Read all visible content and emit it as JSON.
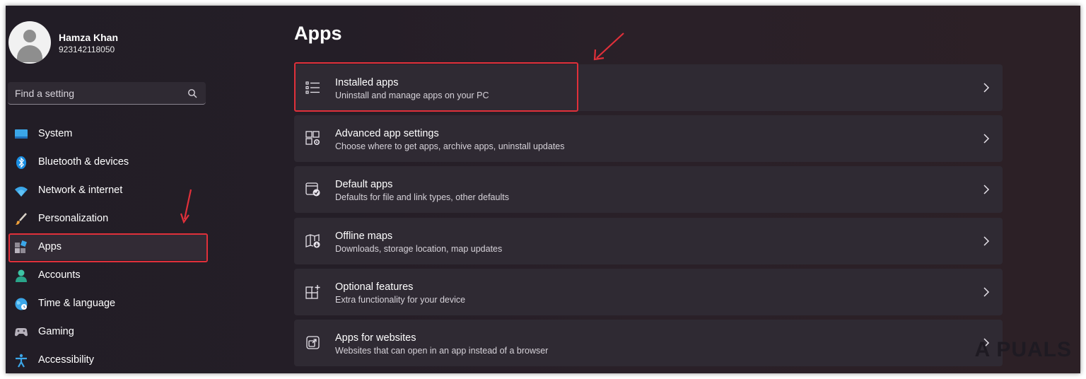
{
  "user": {
    "name": "Hamza Khan",
    "id": "923142118050"
  },
  "search": {
    "placeholder": "Find a setting"
  },
  "sidebar": {
    "items": [
      {
        "label": "System",
        "icon": "system-icon"
      },
      {
        "label": "Bluetooth & devices",
        "icon": "bluetooth-icon"
      },
      {
        "label": "Network & internet",
        "icon": "wifi-icon"
      },
      {
        "label": "Personalization",
        "icon": "brush-icon"
      },
      {
        "label": "Apps",
        "icon": "apps-icon",
        "selected": true
      },
      {
        "label": "Accounts",
        "icon": "person-icon"
      },
      {
        "label": "Time & language",
        "icon": "globe-icon"
      },
      {
        "label": "Gaming",
        "icon": "gamepad-icon"
      },
      {
        "label": "Accessibility",
        "icon": "accessibility-icon"
      }
    ]
  },
  "main": {
    "title": "Apps",
    "cards": [
      {
        "title": "Installed apps",
        "subtitle": "Uninstall and manage apps on your PC",
        "icon": "list-icon"
      },
      {
        "title": "Advanced app settings",
        "subtitle": "Choose where to get apps, archive apps, uninstall updates",
        "icon": "app-settings-icon"
      },
      {
        "title": "Default apps",
        "subtitle": "Defaults for file and link types, other defaults",
        "icon": "default-apps-icon"
      },
      {
        "title": "Offline maps",
        "subtitle": "Downloads, storage location, map updates",
        "icon": "map-icon"
      },
      {
        "title": "Optional features",
        "subtitle": "Extra functionality for your device",
        "icon": "optional-features-icon"
      },
      {
        "title": "Apps for websites",
        "subtitle": "Websites that can open in an app instead of a browser",
        "icon": "apps-websites-icon"
      }
    ]
  },
  "watermark": "A  PUALS",
  "colors": {
    "highlight": "#e0303a",
    "accent": "#4cc2ff"
  }
}
